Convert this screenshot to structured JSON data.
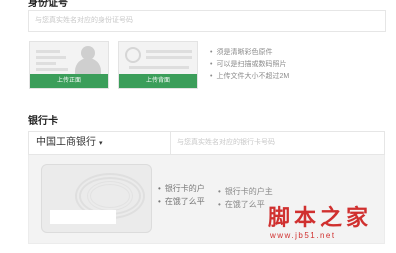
{
  "id_section": {
    "title": "身份证号",
    "input_placeholder": "与您真实姓名对应的身份证号码",
    "front_button": "上传正面",
    "back_button": "上传背面",
    "hints": [
      "须是清晰彩色原件",
      "可以是扫描或数码照片",
      "上传文件大小不超过2M"
    ]
  },
  "bank_section": {
    "title": "银行卡",
    "selected_bank": "中国工商银行",
    "caret": "▾",
    "input_placeholder": "与您真实姓名对应的银行卡号码",
    "hints_primary": [
      "银行卡的户",
      "在饿了么平"
    ],
    "hints_secondary": [
      "银行卡的户主",
      "在饿了么平"
    ]
  },
  "watermark": {
    "title": "脚本之家",
    "url": "www.jb51.net"
  },
  "colors": {
    "accent": "#3b9e5a",
    "watermark": "#d0302f"
  }
}
